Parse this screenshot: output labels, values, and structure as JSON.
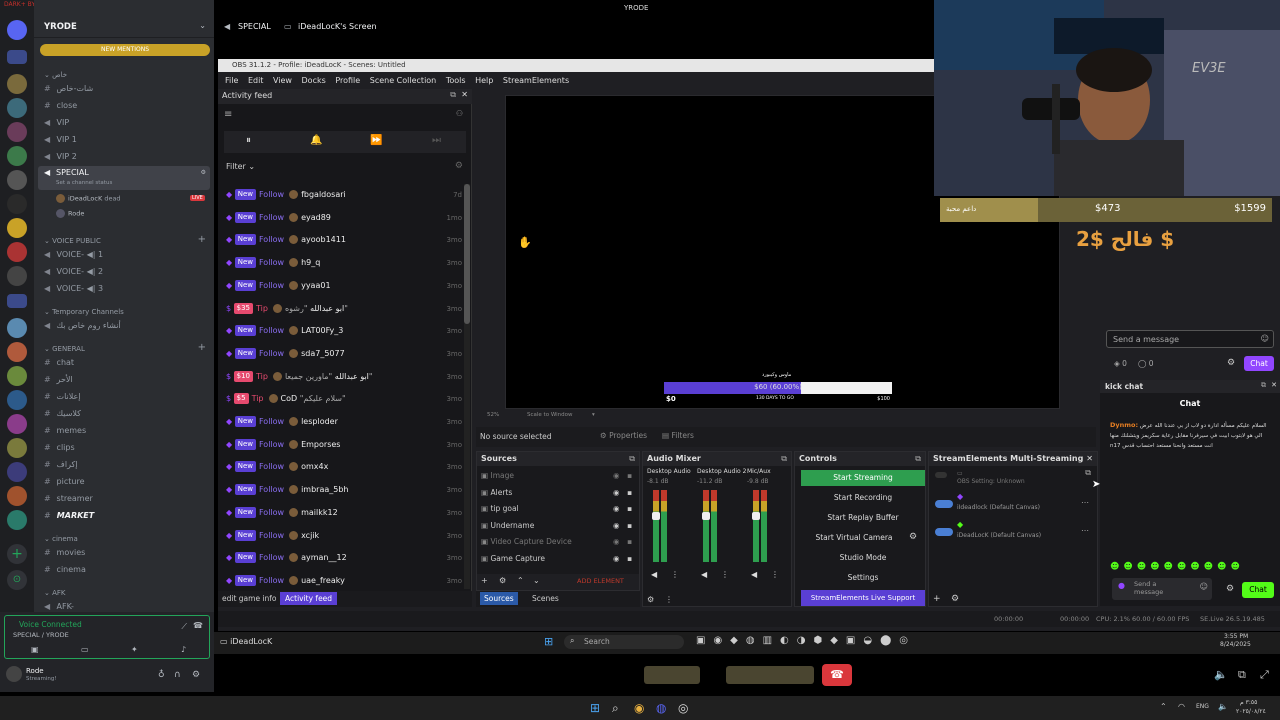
{
  "discord": {
    "top_banner": "DARK+ BY DEVIN#8745",
    "server_name": "YRODE",
    "new_mentions": "NEW MENTIONS",
    "categories": {
      "c1": "خاص",
      "voice": "VOICE PUBLIC",
      "temp": "Temporary Channels",
      "general": "GENERAL",
      "cinema": "cinema",
      "afk": "AFK"
    },
    "channels_top": [
      "شات-خاص",
      "close",
      "VIP",
      "VIP 1",
      "VIP 2"
    ],
    "special": "SPECIAL",
    "special_status": "Set a channel status",
    "special_users": [
      "iDeadLocK",
      "Rode"
    ],
    "special_user_tag": "dead",
    "live_badge": "LIVE",
    "voice_channels": [
      "VOICE-",
      "VOICE-",
      "VOICE-"
    ],
    "voice_counts": [
      "1",
      "2",
      "3"
    ],
    "temp_channel": "أنشاء روم خاص بك",
    "general_channels": [
      "chat",
      "الأحر",
      "إعلانات",
      "كلاسيك",
      "memes",
      "clips",
      "إكراف",
      "picture",
      "streamer",
      "MARKET"
    ],
    "cinema_channels": [
      "movies",
      "cinema"
    ],
    "afk_channel": "AFK-",
    "voice_connected": "Voice Connected",
    "voice_location": "SPECIAL / YRODE",
    "user_name": "Rode",
    "user_status": "Streaming!"
  },
  "stage": {
    "channel": "SPECIAL",
    "screen_title": "iDeadLocK's Screen",
    "window_title": "YRODE"
  },
  "obs": {
    "title": "OBS 31.1.2 - Profile: iDeadLocK - Scenes: Untitled",
    "menu": [
      "File",
      "Edit",
      "View",
      "Docks",
      "Profile",
      "Scene Collection",
      "Tools",
      "Help",
      "StreamElements"
    ],
    "activity_feed_title": "Activity feed",
    "filter_label": "Filter",
    "feed": [
      {
        "type": "New",
        "kind": "Follow",
        "user": "fbgaldosari",
        "time": "7d"
      },
      {
        "type": "New",
        "kind": "Follow",
        "user": "eyad89",
        "time": "1mo"
      },
      {
        "type": "New",
        "kind": "Follow",
        "user": "ayoob1411",
        "time": "3mo"
      },
      {
        "type": "New",
        "kind": "Follow",
        "user": "h9_q",
        "time": "3mo"
      },
      {
        "type": "New",
        "kind": "Follow",
        "user": "yyaa01",
        "time": "3mo"
      },
      {
        "type": "$35",
        "kind": "Tip",
        "user": "ابو عبدالله",
        "msg": "\"رشوه\"",
        "time": "3mo"
      },
      {
        "type": "New",
        "kind": "Follow",
        "user": "LAT00Fy_3",
        "time": "3mo"
      },
      {
        "type": "New",
        "kind": "Follow",
        "user": "sda7_5077",
        "time": "3mo"
      },
      {
        "type": "$10",
        "kind": "Tip",
        "user": "ابو عبدالله",
        "msg": "\"ماورين جميعا\"",
        "time": "3mo"
      },
      {
        "type": "$5",
        "kind": "Tip",
        "user": "CoD",
        "msg": "\"سلام عليكم\"",
        "time": "3mo"
      },
      {
        "type": "New",
        "kind": "Follow",
        "user": "lesploder",
        "time": "3mo"
      },
      {
        "type": "New",
        "kind": "Follow",
        "user": "Emporses",
        "time": "3mo"
      },
      {
        "type": "New",
        "kind": "Follow",
        "user": "omx4x",
        "time": "3mo"
      },
      {
        "type": "New",
        "kind": "Follow",
        "user": "imbraa_5bh",
        "time": "3mo"
      },
      {
        "type": "New",
        "kind": "Follow",
        "user": "mailkk12",
        "time": "3mo"
      },
      {
        "type": "New",
        "kind": "Follow",
        "user": "xcjik",
        "time": "3mo"
      },
      {
        "type": "New",
        "kind": "Follow",
        "user": "ayman__12",
        "time": "3mo"
      },
      {
        "type": "New",
        "kind": "Follow",
        "user": "uae_freaky",
        "time": "3mo"
      }
    ],
    "feed_tabs": [
      "edit game info",
      "Activity feed"
    ],
    "preview": {
      "goal_title": "ماوس وكيبورد",
      "goal_bar_text": "$60 (60.00%)",
      "goal_progress": 0.6,
      "goal_start": "$0",
      "goal_days": "130 DAYS TO GO",
      "goal_end": "$100"
    },
    "zoom_label": "52%",
    "scale_label": "Scale to Window",
    "no_source": "No source selected",
    "properties_btn": "Properties",
    "filters_btn": "Filters",
    "sources_title": "Sources",
    "sources": [
      "Image",
      "Alerts",
      "tip goal",
      "Undername",
      "Video Capture Device",
      "Game Capture"
    ],
    "add_element": "ADD ELEMENT",
    "bottom_tabs": [
      "Sources",
      "Scenes"
    ],
    "audio_title": "Audio Mixer",
    "audio_channels": [
      {
        "name": "Desktop Audio",
        "db": "-8.1 dB"
      },
      {
        "name": "Desktop Audio 2",
        "db": "-11.2 dB"
      },
      {
        "name": "Mic/Aux",
        "db": "-9.8 dB"
      }
    ],
    "controls_title": "Controls",
    "controls": [
      "Start Streaming",
      "Start Recording",
      "Start Replay Buffer",
      "Start Virtual Camera",
      "Studio Mode",
      "Settings"
    ],
    "se_live": "StreamElements Live Support",
    "multistream_title": "StreamElements Multi-Streaming",
    "multistream": [
      "OBS Setting: Unknown",
      "iIdeadlock (Default Canvas)",
      "iDeadLocK (Default Canvas)"
    ],
    "status": {
      "t1": "00:00:00",
      "t2": "00:00:00",
      "cpu": "CPU: 2.1%",
      "fps": "60.00 / 60.00 FPS",
      "se": "SE.Live 26.5.19.485"
    }
  },
  "overlay": {
    "goal_label": "داعم محبة",
    "goal_mid": "$473",
    "goal_max": "$1599",
    "donation_text": "2$ فالح $",
    "chat_placeholder": "Send a message",
    "chat_counts": [
      "0",
      "0"
    ],
    "chat_button": "Chat",
    "kick_title": "kick chat",
    "kick_header": "Chat",
    "kick_msg_user": "Dynmo:",
    "kick_msg": "السلام عليكم مسأله ادارة دو لاب از بي عندنا الله عرض الي هو لابتوب ابيت في سيرفرنا مقابل رعاية سكريمز ويتشلنك منها n17 انت مستعد وانحنا مستعد احتساب قدس",
    "kick_input": "Send a message",
    "kick_chat_btn": "Chat"
  },
  "taskbar": {
    "app": "iDeadLocK",
    "search": "Search",
    "time": "3:55 PM",
    "date": "8/24/2025",
    "lang": "ENG",
    "win_time": "٣:٥٥ م",
    "win_date": "٢٠٢٥/٠٨/٢٤"
  }
}
